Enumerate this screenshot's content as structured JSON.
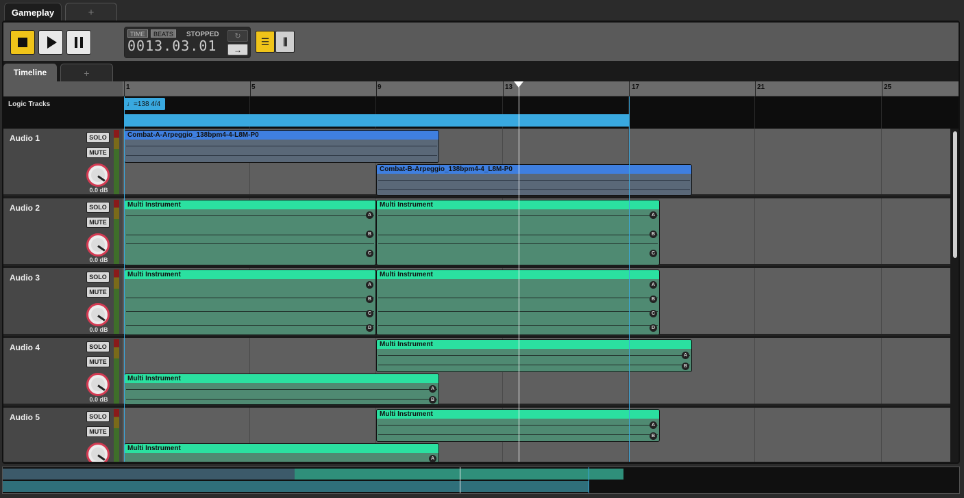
{
  "tabs": {
    "active": "Gameplay",
    "add": "+"
  },
  "transport": {
    "time_tag": "TIME",
    "beats_tag": "BEATS",
    "status": "STOPPED",
    "position": "0013.03.01",
    "loop_icon": "↻",
    "arrow_icon": "→"
  },
  "subtabs": {
    "active": "Timeline",
    "add": "+"
  },
  "ruler": {
    "marks": [
      "1",
      "5",
      "9",
      "13",
      "17",
      "21",
      "25"
    ]
  },
  "logic": {
    "label": "Logic Tracks",
    "tempo": "♩=138 4/4"
  },
  "tracks": [
    {
      "name": "Audio 1",
      "solo": "SOLO",
      "mute": "MUTE",
      "gain": "0.0 dB"
    },
    {
      "name": "Audio 2",
      "solo": "SOLO",
      "mute": "MUTE",
      "gain": "0.0 dB"
    },
    {
      "name": "Audio 3",
      "solo": "SOLO",
      "mute": "MUTE",
      "gain": "0.0 dB"
    },
    {
      "name": "Audio 4",
      "solo": "SOLO",
      "mute": "MUTE",
      "gain": "0.0 dB"
    },
    {
      "name": "Audio 5",
      "solo": "SOLO",
      "mute": "MUTE",
      "gain": ""
    }
  ],
  "clips": {
    "a1_1": "Combat-A-Arpeggio_138bpm4-4-L8M-P0",
    "a1_2": "Combat-B-Arpeggio_138bpm4-4_L8M-P0",
    "multi": "Multi Instrument"
  },
  "channels": [
    "A",
    "B",
    "C",
    "D"
  ]
}
